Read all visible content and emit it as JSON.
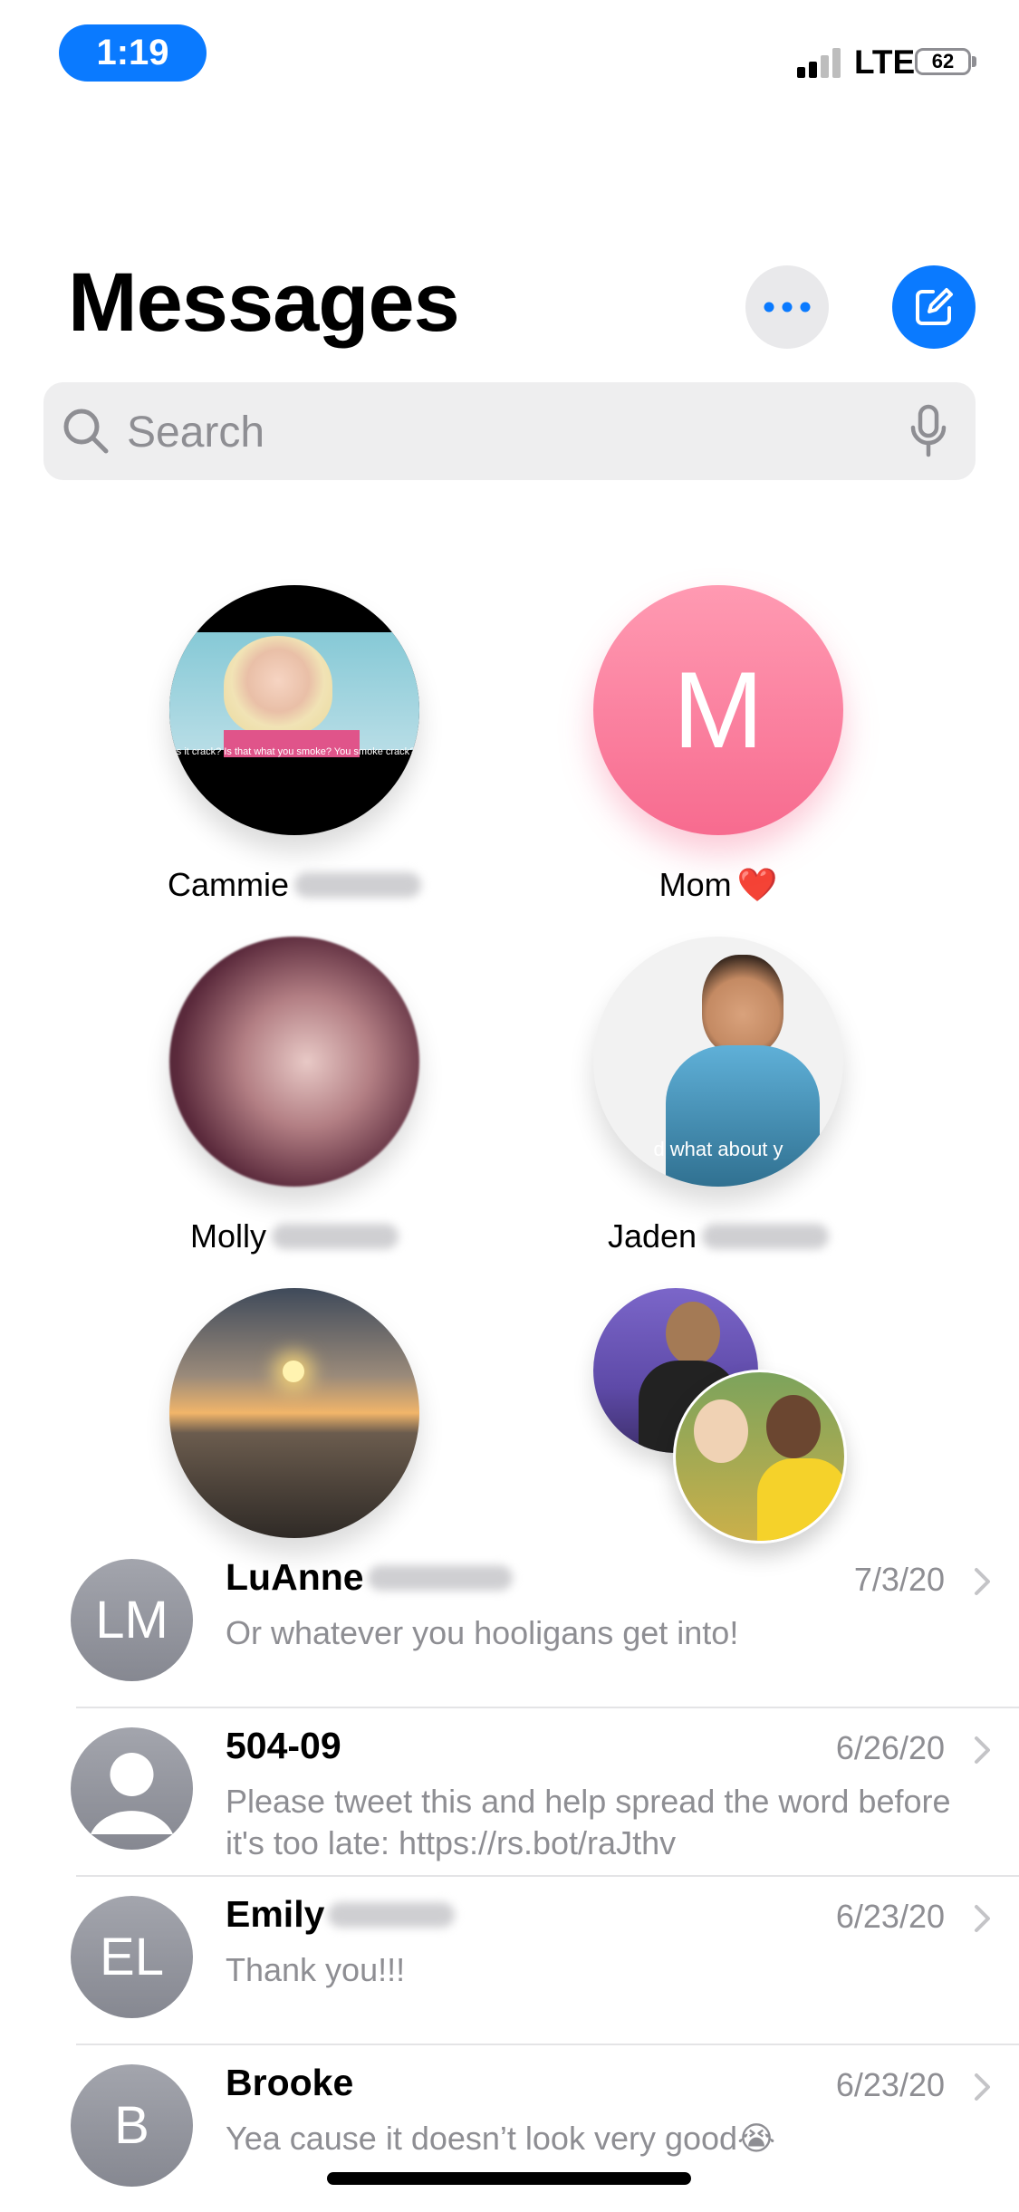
{
  "status_bar": {
    "time": "1:19",
    "network": "LTE",
    "battery": "62"
  },
  "header": {
    "title": "Messages"
  },
  "search": {
    "placeholder": "Search"
  },
  "pinned": [
    {
      "name": "Cammie"
    },
    {
      "name": "Mom",
      "emoji": "❤️"
    },
    {
      "name": "Molly"
    },
    {
      "name": "Jaden"
    },
    {
      "name": ""
    },
    {
      "name": ""
    }
  ],
  "photo_caption": "Is it crack? Is that what you smoke? You smoke crack?",
  "photo_overlay_text": "d what about y",
  "pinned_initial": "M",
  "conversations": [
    {
      "initials": "LM",
      "name": "LuAnne",
      "date": "7/3/20",
      "preview": "Or whatever you hooligans get into!"
    },
    {
      "initials": "",
      "name": "504-09",
      "date": "6/26/20",
      "preview": "Please tweet this and help spread the word before it's too late: https://rs.bot/raJthv"
    },
    {
      "initials": "EL",
      "name": "Emily",
      "date": "6/23/20",
      "preview": "Thank you!!!"
    },
    {
      "initials": "B",
      "name": "Brooke",
      "date": "6/23/20",
      "preview": "Yea cause it doesn’t look very good😭"
    }
  ],
  "colors": {
    "accent": "#0a7aff",
    "secondary_text": "#8e8e93"
  }
}
